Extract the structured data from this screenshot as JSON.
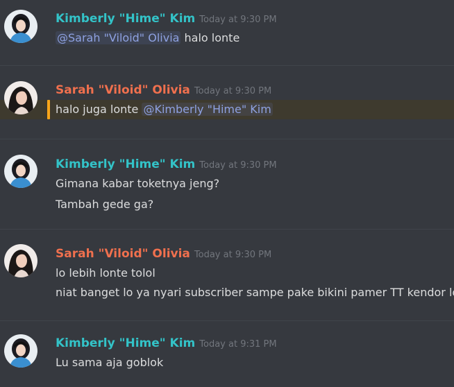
{
  "colors": {
    "background": "#36393f",
    "divider": "#40444b",
    "kimberly_name": "#33c3c8",
    "sarah_name": "#f0704e",
    "message_text": "#dcddde",
    "timestamp": "#72767d",
    "mention_text": "#8ea1e1",
    "mention_highlight_bar": "#faa61a",
    "mention_highlight_bg": "#3e3a2e"
  },
  "messages": [
    {
      "author": "Kimberly \"Hime\" Kim",
      "timestamp": "Today at 9:30 PM",
      "lines": [
        {
          "mention": "@Sarah \"Viloid\" Olivia",
          "text": " halo lonte"
        }
      ]
    },
    {
      "author": "Sarah \"Viloid\" Olivia",
      "timestamp": "Today at 9:30 PM",
      "highlighted": true,
      "lines": [
        {
          "text": "halo juga lonte ",
          "mention": "@Kimberly \"Hime\" Kim"
        }
      ]
    },
    {
      "author": "Kimberly \"Hime\" Kim",
      "timestamp": "Today at 9:30 PM",
      "lines": [
        {
          "text": "Gimana kabar toketnya jeng?"
        },
        {
          "text": "Tambah gede ga?"
        }
      ]
    },
    {
      "author": "Sarah \"Viloid\" Olivia",
      "timestamp": "Today at 9:30 PM",
      "lines": [
        {
          "text": "lo lebih lonte tolol"
        },
        {
          "text": "niat banget lo ya nyari subscriber sampe pake bikini pamer TT kendor lo"
        }
      ]
    },
    {
      "author": "Kimberly \"Hime\" Kim",
      "timestamp": "Today at 9:31 PM",
      "lines": [
        {
          "text": "Lu sama aja goblok"
        }
      ]
    }
  ]
}
